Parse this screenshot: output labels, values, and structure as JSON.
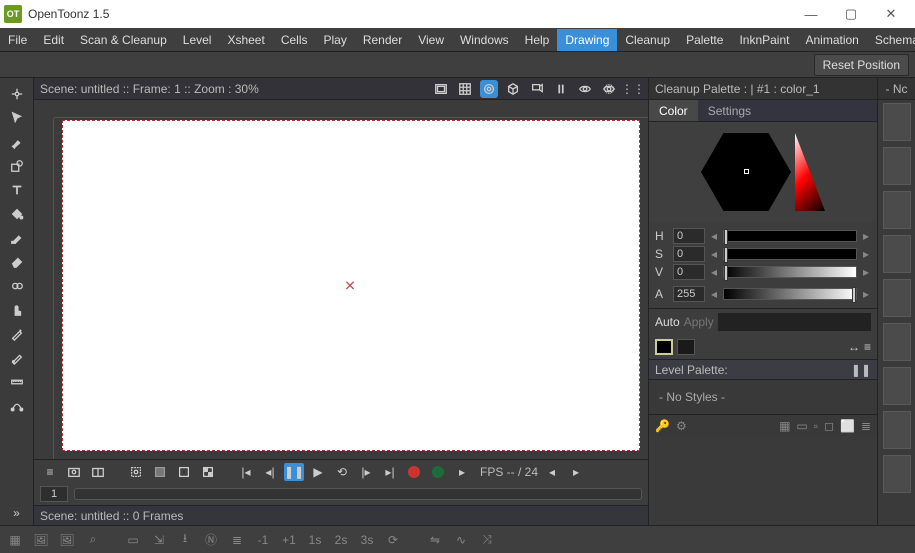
{
  "titlebar": {
    "app": "OpenToonz 1.5",
    "logo": "OT"
  },
  "menu": {
    "items": [
      "File",
      "Edit",
      "Scan & Cleanup",
      "Level",
      "Xsheet",
      "Cells",
      "Play",
      "Render",
      "View",
      "Windows",
      "Help",
      "Drawing",
      "Cleanup",
      "Palette",
      "InknPaint",
      "Animation",
      "Schemat"
    ],
    "active": "Drawing"
  },
  "toolbar": {
    "reset": "Reset Position"
  },
  "viewer": {
    "info": "Scene: untitled  ::  Frame: 1  ::  Zoom : 30%"
  },
  "playbar": {
    "fps": "FPS -- / 24"
  },
  "frame": {
    "current": "1"
  },
  "status": {
    "text": "Scene: untitled  ::  0 Frames"
  },
  "cleanup": {
    "title": "Cleanup Palette :  | #1 : color_1"
  },
  "tabs": {
    "color": "Color",
    "settings": "Settings"
  },
  "hsv": {
    "h": {
      "label": "H",
      "val": "0"
    },
    "s": {
      "label": "S",
      "val": "0"
    },
    "v": {
      "label": "V",
      "val": "0"
    },
    "a": {
      "label": "A",
      "val": "255"
    }
  },
  "auto": {
    "auto": "Auto",
    "apply": "Apply"
  },
  "levelpalette": {
    "title": "Level Palette:",
    "nostyles": "- No Styles -"
  },
  "swatchdrop": {
    "label": "- Nc"
  },
  "bottom": {
    "t1": "-1",
    "t2": "+1",
    "t3": "1s",
    "t4": "2s",
    "t5": "3s"
  }
}
